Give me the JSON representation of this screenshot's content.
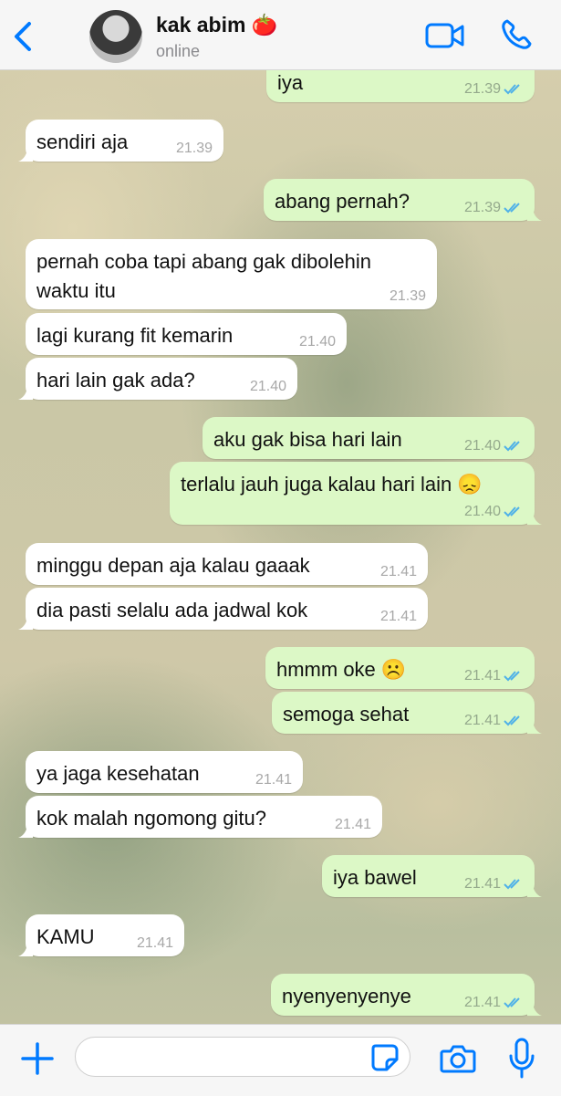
{
  "header": {
    "contact_name": "kak abim 🍅",
    "status": "online"
  },
  "messages": [
    {
      "dir": "out",
      "text": "iya",
      "time": "21.39",
      "read": true
    },
    {
      "dir": "in",
      "text": "sendiri aja",
      "time": "21.39"
    },
    {
      "dir": "out",
      "text": "abang pernah?",
      "time": "21.39",
      "read": true
    },
    {
      "dir": "in",
      "text": "pernah coba tapi abang gak dibolehin",
      "text2": "waktu itu",
      "time": "21.39"
    },
    {
      "dir": "in",
      "text": "lagi kurang fit kemarin",
      "time": "21.40"
    },
    {
      "dir": "in",
      "text": "hari lain gak ada?",
      "time": "21.40"
    },
    {
      "dir": "out",
      "text": "aku gak bisa hari lain",
      "time": "21.40",
      "read": true
    },
    {
      "dir": "out",
      "text": "terlalu jauh juga kalau hari lain 😞",
      "time": "21.40",
      "read": true
    },
    {
      "dir": "in",
      "text": "minggu depan aja kalau gaaak",
      "time": "21.41"
    },
    {
      "dir": "in",
      "text": "dia pasti selalu ada jadwal kok",
      "time": "21.41"
    },
    {
      "dir": "out",
      "text": "hmmm oke ☹️",
      "time": "21.41",
      "read": true
    },
    {
      "dir": "out",
      "text": "semoga sehat",
      "time": "21.41",
      "read": true
    },
    {
      "dir": "in",
      "text": "ya jaga kesehatan",
      "time": "21.41"
    },
    {
      "dir": "in",
      "text": "kok malah ngomong gitu?",
      "time": "21.41"
    },
    {
      "dir": "out",
      "text": "iya bawel",
      "time": "21.41",
      "read": true
    },
    {
      "dir": "in",
      "text": "KAMU",
      "time": "21.41"
    },
    {
      "dir": "out",
      "text": "nyenyenyenye",
      "time": "21.41",
      "read": true
    }
  ],
  "input": {
    "value": "",
    "placeholder": ""
  },
  "colors": {
    "accent": "#007aff",
    "tick": "#4fb1e8",
    "outgoing_bubble": "#dcf8c6",
    "incoming_bubble": "#ffffff"
  },
  "icons": [
    "back-arrow-icon",
    "video-call-icon",
    "phone-icon",
    "plus-icon",
    "sticker-icon",
    "camera-icon",
    "microphone-icon"
  ]
}
